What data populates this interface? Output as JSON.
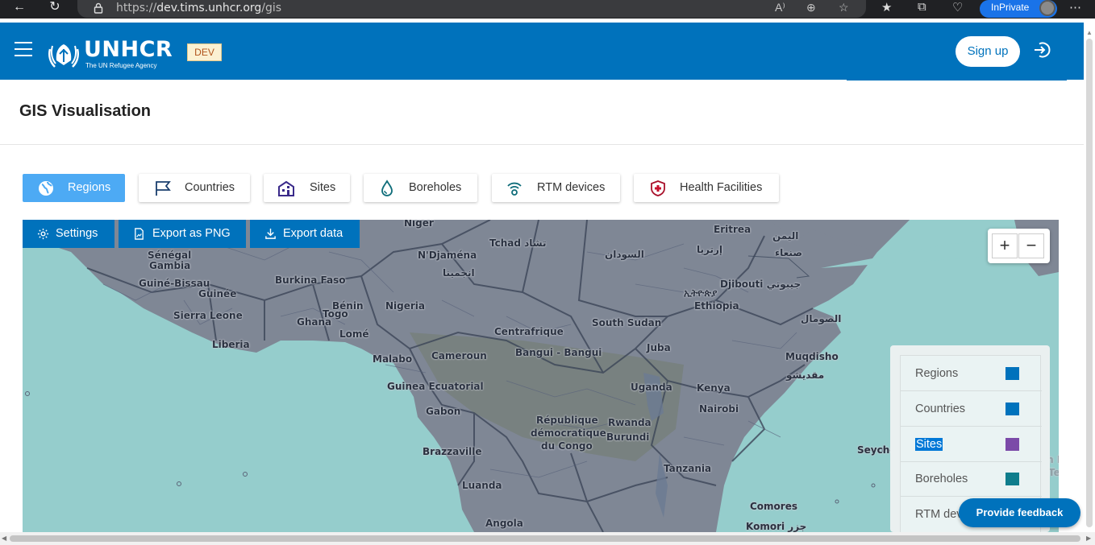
{
  "browser": {
    "url_prefix": "https://",
    "url_host": "dev.tims.unhcr.org",
    "url_path": "/gis",
    "profile_label": "InPrivate",
    "icons": [
      "back-icon",
      "refresh-icon",
      "lock-icon",
      "read-aloud-icon",
      "zoom-icon",
      "favorite-icon",
      "favorites-icon",
      "collections-icon",
      "health-icon",
      "more-icon"
    ]
  },
  "header": {
    "logo_text": "UNHCR",
    "logo_subtitle": "The UN Refugee Agency",
    "env_badge": "DEV",
    "signup_label": "Sign up",
    "brand_color": "#0072bc"
  },
  "page": {
    "title": "GIS Visualisation"
  },
  "layer_tabs": [
    {
      "label": "Regions",
      "icon": "globe-icon",
      "active": true
    },
    {
      "label": "Countries",
      "icon": "flag-icon",
      "active": false
    },
    {
      "label": "Sites",
      "icon": "building-icon",
      "active": false
    },
    {
      "label": "Boreholes",
      "icon": "water-drop-icon",
      "active": false
    },
    {
      "label": "RTM devices",
      "icon": "wifi-sensor-icon",
      "active": false
    },
    {
      "label": "Health Facilities",
      "icon": "health-shield-icon",
      "active": false
    }
  ],
  "map_toolbar": {
    "settings_label": "Settings",
    "export_png_label": "Export as PNG",
    "export_data_label": "Export data"
  },
  "zoom": {
    "in": "+",
    "out": "−"
  },
  "map_labels": [
    "Niger",
    "Tchad تشاد",
    "Sénégal",
    "Gambia",
    "N'Djaména",
    "انجمينا",
    "السودان",
    "إرتريا",
    "Eritrea",
    "اليمن",
    "صنعاء",
    "Guiné-Bissau",
    "Burkina Faso",
    "Guinée",
    "Bénin",
    "Togo",
    "Nigeria",
    "Djibouti جيبوتي",
    "Ethiopia",
    "ኢትዮጵያ",
    "Sierra Leone",
    "Ghana",
    "Lomé",
    "South Sudan",
    "الصومال",
    "Liberia",
    "Centrafrique",
    "Malabo",
    "Cameroun",
    "Bangui - Bangui",
    "Juba",
    "Muqdisho",
    "مقديشو",
    "Guinea Ecuatorial",
    "Uganda",
    "Kenya",
    "Gabon",
    "République",
    "démocratique",
    "du Congo",
    "Rwanda",
    "Nairobi",
    "Burundi",
    "Brazzaville",
    "Seychelles",
    "Tanzania",
    "Luanda",
    "Angola",
    "Comores",
    "Komori جزر",
    "British Ir",
    "cean Ter"
  ],
  "legend": [
    {
      "label": "Regions",
      "color": "#0072bc",
      "selected": false
    },
    {
      "label": "Countries",
      "color": "#0072bc",
      "selected": false
    },
    {
      "label": "Sites",
      "color": "#7b4aa8",
      "selected": true
    },
    {
      "label": "Boreholes",
      "color": "#0f7d8c",
      "selected": false
    },
    {
      "label": "RTM devices",
      "color": "#0072bc",
      "selected": false
    }
  ],
  "feedback_label": "Provide feedback"
}
